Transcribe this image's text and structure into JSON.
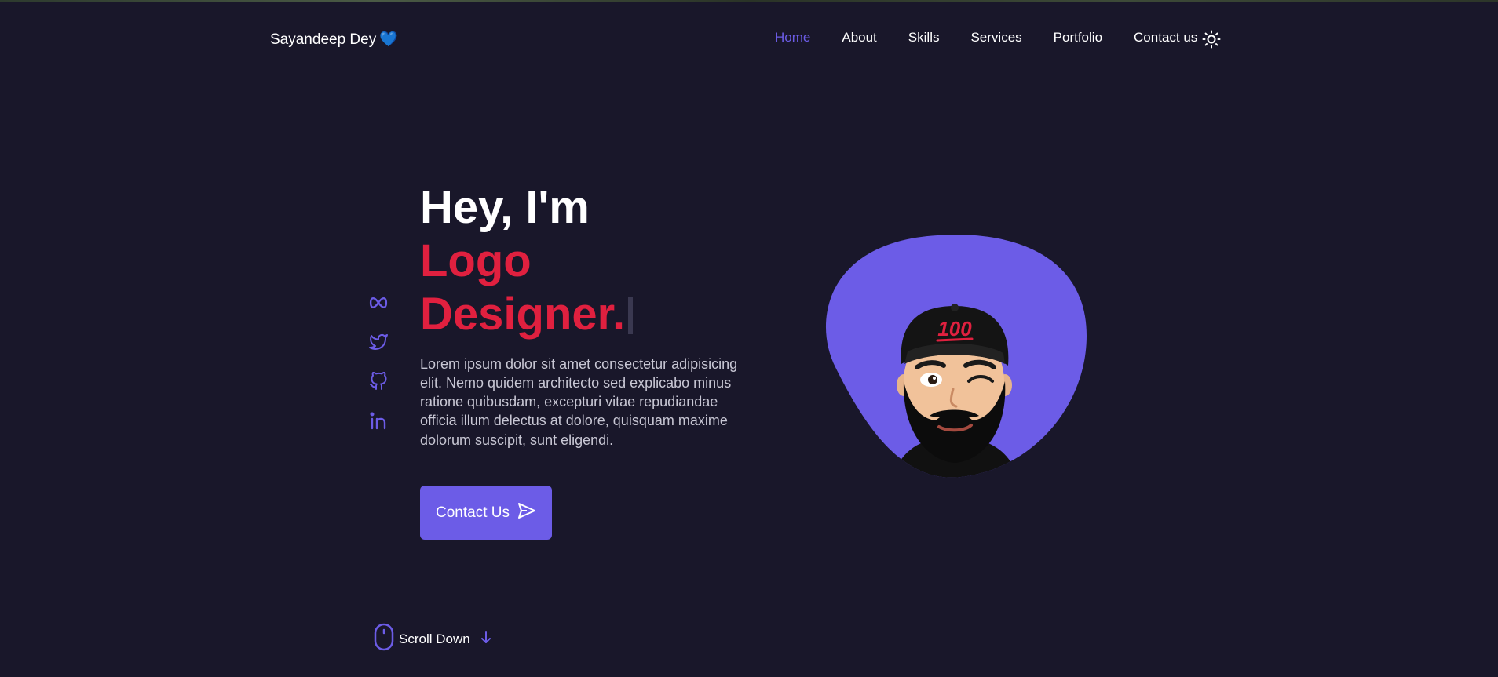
{
  "brand": {
    "name": "Sayandeep Dey",
    "emoji": "💙"
  },
  "nav": {
    "items": [
      {
        "label": "Home",
        "active": true
      },
      {
        "label": "About",
        "active": false
      },
      {
        "label": "Skills",
        "active": false
      },
      {
        "label": "Services",
        "active": false
      },
      {
        "label": "Portfolio",
        "active": false
      },
      {
        "label": "Contact us",
        "active": false
      }
    ],
    "theme_icon": "sun-icon"
  },
  "social": {
    "icons": [
      "meta-icon",
      "twitter-icon",
      "github-icon",
      "linkedin-icon"
    ]
  },
  "hero": {
    "greeting": "Hey, I'm",
    "role": "Logo Designer.",
    "description": "Lorem ipsum dolor sit amet consectetur adipisicing elit. Nemo quidem architecto sed explicabo minus ratione quibusdam, excepturi vitae repudiandae officia illum delectus at dolore, quisquam maxime dolorum suscipit, sunt eligendi.",
    "cta_label": "Contact Us",
    "cta_icon": "send-icon",
    "avatar_icon": "avatar-illustration"
  },
  "scroll": {
    "label": "Scroll Down",
    "mouse_icon": "mouse-icon",
    "arrow_icon": "arrow-down-icon"
  },
  "colors": {
    "background": "#19172a",
    "accent": "#6c5ce7",
    "role_text": "#e0203f",
    "text": "#ffffff",
    "muted_text": "#c8c7d4"
  }
}
